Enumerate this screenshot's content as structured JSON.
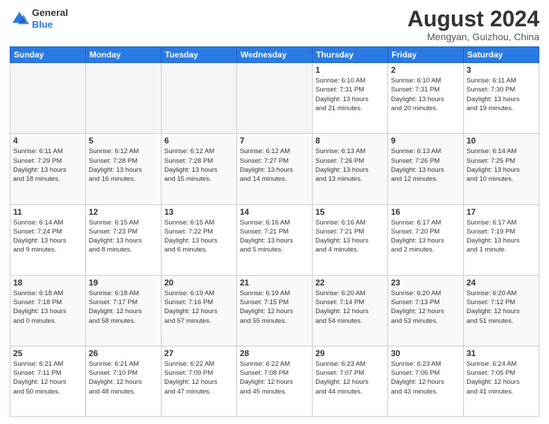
{
  "header": {
    "logo_general": "General",
    "logo_blue": "Blue",
    "month_year": "August 2024",
    "location": "Mengyan, Guizhou, China"
  },
  "weekdays": [
    "Sunday",
    "Monday",
    "Tuesday",
    "Wednesday",
    "Thursday",
    "Friday",
    "Saturday"
  ],
  "weeks": [
    [
      {
        "day": "",
        "info": ""
      },
      {
        "day": "",
        "info": ""
      },
      {
        "day": "",
        "info": ""
      },
      {
        "day": "",
        "info": ""
      },
      {
        "day": "1",
        "info": "Sunrise: 6:10 AM\nSunset: 7:31 PM\nDaylight: 13 hours\nand 21 minutes."
      },
      {
        "day": "2",
        "info": "Sunrise: 6:10 AM\nSunset: 7:31 PM\nDaylight: 13 hours\nand 20 minutes."
      },
      {
        "day": "3",
        "info": "Sunrise: 6:11 AM\nSunset: 7:30 PM\nDaylight: 13 hours\nand 19 minutes."
      }
    ],
    [
      {
        "day": "4",
        "info": "Sunrise: 6:11 AM\nSunset: 7:29 PM\nDaylight: 13 hours\nand 18 minutes."
      },
      {
        "day": "5",
        "info": "Sunrise: 6:12 AM\nSunset: 7:28 PM\nDaylight: 13 hours\nand 16 minutes."
      },
      {
        "day": "6",
        "info": "Sunrise: 6:12 AM\nSunset: 7:28 PM\nDaylight: 13 hours\nand 15 minutes."
      },
      {
        "day": "7",
        "info": "Sunrise: 6:12 AM\nSunset: 7:27 PM\nDaylight: 13 hours\nand 14 minutes."
      },
      {
        "day": "8",
        "info": "Sunrise: 6:13 AM\nSunset: 7:26 PM\nDaylight: 13 hours\nand 13 minutes."
      },
      {
        "day": "9",
        "info": "Sunrise: 6:13 AM\nSunset: 7:26 PM\nDaylight: 13 hours\nand 12 minutes."
      },
      {
        "day": "10",
        "info": "Sunrise: 6:14 AM\nSunset: 7:25 PM\nDaylight: 13 hours\nand 10 minutes."
      }
    ],
    [
      {
        "day": "11",
        "info": "Sunrise: 6:14 AM\nSunset: 7:24 PM\nDaylight: 13 hours\nand 9 minutes."
      },
      {
        "day": "12",
        "info": "Sunrise: 6:15 AM\nSunset: 7:23 PM\nDaylight: 13 hours\nand 8 minutes."
      },
      {
        "day": "13",
        "info": "Sunrise: 6:15 AM\nSunset: 7:22 PM\nDaylight: 13 hours\nand 6 minutes."
      },
      {
        "day": "14",
        "info": "Sunrise: 6:16 AM\nSunset: 7:21 PM\nDaylight: 13 hours\nand 5 minutes."
      },
      {
        "day": "15",
        "info": "Sunrise: 6:16 AM\nSunset: 7:21 PM\nDaylight: 13 hours\nand 4 minutes."
      },
      {
        "day": "16",
        "info": "Sunrise: 6:17 AM\nSunset: 7:20 PM\nDaylight: 13 hours\nand 2 minutes."
      },
      {
        "day": "17",
        "info": "Sunrise: 6:17 AM\nSunset: 7:19 PM\nDaylight: 13 hours\nand 1 minute."
      }
    ],
    [
      {
        "day": "18",
        "info": "Sunrise: 6:18 AM\nSunset: 7:18 PM\nDaylight: 13 hours\nand 0 minutes."
      },
      {
        "day": "19",
        "info": "Sunrise: 6:18 AM\nSunset: 7:17 PM\nDaylight: 12 hours\nand 58 minutes."
      },
      {
        "day": "20",
        "info": "Sunrise: 6:19 AM\nSunset: 7:16 PM\nDaylight: 12 hours\nand 57 minutes."
      },
      {
        "day": "21",
        "info": "Sunrise: 6:19 AM\nSunset: 7:15 PM\nDaylight: 12 hours\nand 55 minutes."
      },
      {
        "day": "22",
        "info": "Sunrise: 6:20 AM\nSunset: 7:14 PM\nDaylight: 12 hours\nand 54 minutes."
      },
      {
        "day": "23",
        "info": "Sunrise: 6:20 AM\nSunset: 7:13 PM\nDaylight: 12 hours\nand 53 minutes."
      },
      {
        "day": "24",
        "info": "Sunrise: 6:20 AM\nSunset: 7:12 PM\nDaylight: 12 hours\nand 51 minutes."
      }
    ],
    [
      {
        "day": "25",
        "info": "Sunrise: 6:21 AM\nSunset: 7:11 PM\nDaylight: 12 hours\nand 50 minutes."
      },
      {
        "day": "26",
        "info": "Sunrise: 6:21 AM\nSunset: 7:10 PM\nDaylight: 12 hours\nand 48 minutes."
      },
      {
        "day": "27",
        "info": "Sunrise: 6:22 AM\nSunset: 7:09 PM\nDaylight: 12 hours\nand 47 minutes."
      },
      {
        "day": "28",
        "info": "Sunrise: 6:22 AM\nSunset: 7:08 PM\nDaylight: 12 hours\nand 45 minutes."
      },
      {
        "day": "29",
        "info": "Sunrise: 6:23 AM\nSunset: 7:07 PM\nDaylight: 12 hours\nand 44 minutes."
      },
      {
        "day": "30",
        "info": "Sunrise: 6:23 AM\nSunset: 7:06 PM\nDaylight: 12 hours\nand 43 minutes."
      },
      {
        "day": "31",
        "info": "Sunrise: 6:24 AM\nSunset: 7:05 PM\nDaylight: 12 hours\nand 41 minutes."
      }
    ]
  ]
}
